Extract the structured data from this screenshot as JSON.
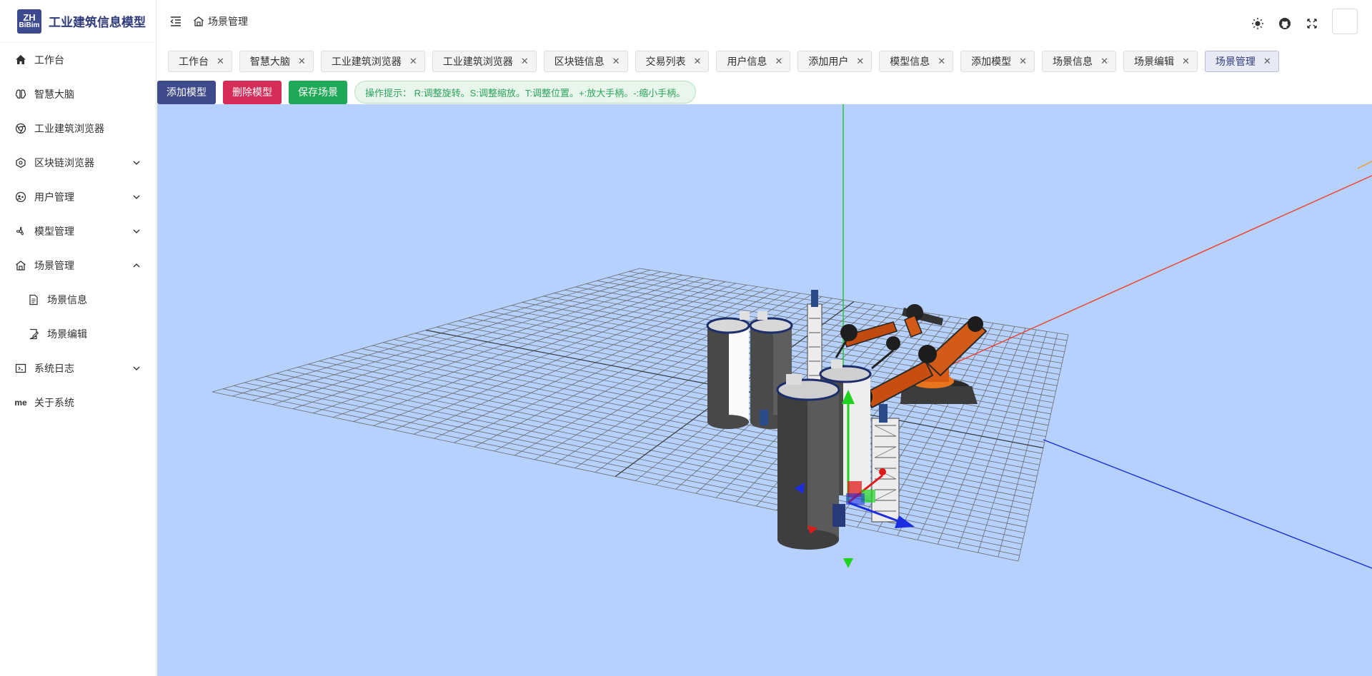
{
  "app": {
    "logo_top": "ZH",
    "logo_bottom": "BiBim",
    "title": "工业建筑信息模型"
  },
  "sidebar": {
    "items": [
      {
        "label": "工作台"
      },
      {
        "label": "智慧大脑"
      },
      {
        "label": "工业建筑浏览器"
      },
      {
        "label": "区块链浏览器"
      },
      {
        "label": "用户管理"
      },
      {
        "label": "模型管理"
      },
      {
        "label": "场景管理"
      },
      {
        "label": "场景信息"
      },
      {
        "label": "场景编辑"
      },
      {
        "label": "系统日志"
      },
      {
        "label": "关于系统",
        "icon_text": "me"
      }
    ]
  },
  "header": {
    "breadcrumb": "场景管理"
  },
  "tabs": [
    {
      "label": "工作台"
    },
    {
      "label": "智慧大脑"
    },
    {
      "label": "工业建筑浏览器"
    },
    {
      "label": "工业建筑浏览器"
    },
    {
      "label": "区块链信息"
    },
    {
      "label": "交易列表"
    },
    {
      "label": "用户信息"
    },
    {
      "label": "添加用户"
    },
    {
      "label": "模型信息"
    },
    {
      "label": "添加模型"
    },
    {
      "label": "场景信息"
    },
    {
      "label": "场景编辑"
    },
    {
      "label": "场景管理"
    }
  ],
  "toolbar": {
    "add_model": "添加模型",
    "delete_model": "删除模型",
    "save_scene": "保存场景",
    "hint": "操作提示： R:调整旋转。S:调整缩放。T:调整位置。+:放大手柄。-:缩小手柄。"
  },
  "colors": {
    "primary": "#3e4a8c",
    "danger": "#d52d57",
    "success": "#1fa855",
    "scene_bg": "#b6d1fd"
  }
}
